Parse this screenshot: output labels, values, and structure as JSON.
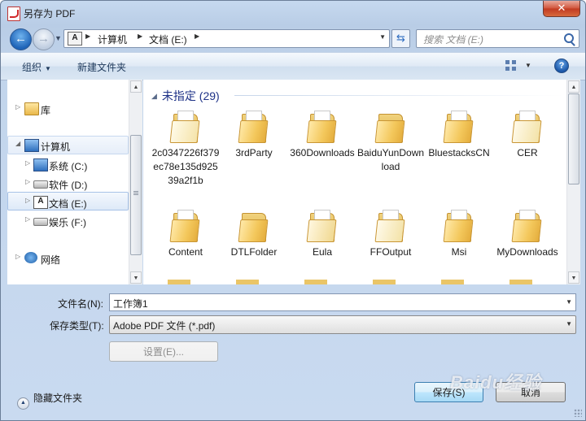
{
  "window": {
    "title": "另存为 PDF",
    "close_label": "✕"
  },
  "address": {
    "breadcrumbs": [
      "计算机",
      "文档 (E:)"
    ],
    "search_placeholder": "搜索 文档 (E:)"
  },
  "toolbar": {
    "organize_label": "组织",
    "new_folder_label": "新建文件夹",
    "help_label": "?"
  },
  "nav": {
    "items": [
      {
        "label": "库",
        "icon": "library-icon"
      },
      {
        "label": "计算机",
        "icon": "computer-icon"
      },
      {
        "label": "系统 (C:)",
        "icon": "system-drive-icon"
      },
      {
        "label": "软件 (D:)",
        "icon": "drive-icon"
      },
      {
        "label": "文档 (E:)",
        "icon": "document-drive-icon",
        "selected": true
      },
      {
        "label": "娱乐 (F:)",
        "icon": "drive-icon"
      },
      {
        "label": "网络",
        "icon": "network-icon"
      }
    ]
  },
  "files": {
    "group_header": "未指定 (29)",
    "items": [
      {
        "name": "2c0347226f379ec78e135d92539a2f1b"
      },
      {
        "name": "3rdParty"
      },
      {
        "name": "360Downloads"
      },
      {
        "name": "BaiduYunDownload"
      },
      {
        "name": "BluestacksCN"
      },
      {
        "name": "CER"
      },
      {
        "name": "Content"
      },
      {
        "name": "DTLFolder"
      },
      {
        "name": "Eula"
      },
      {
        "name": "FFOutput"
      },
      {
        "name": "Msi"
      },
      {
        "name": "MyDownloads"
      }
    ]
  },
  "form": {
    "filename_label": "文件名(N):",
    "filename_value": "工作簿1",
    "filetype_label": "保存类型(T):",
    "filetype_value": "Adobe PDF 文件 (*.pdf)",
    "settings_label": "设置(E)...",
    "save_label": "保存(S)",
    "cancel_label": "取消",
    "hide_folders_label": "隐藏文件夹"
  },
  "watermark": "Baidu经验",
  "colors": {
    "group_header": "#1e3287",
    "selection_border": "#a7c2e6",
    "frame": "#c2d5ec"
  }
}
